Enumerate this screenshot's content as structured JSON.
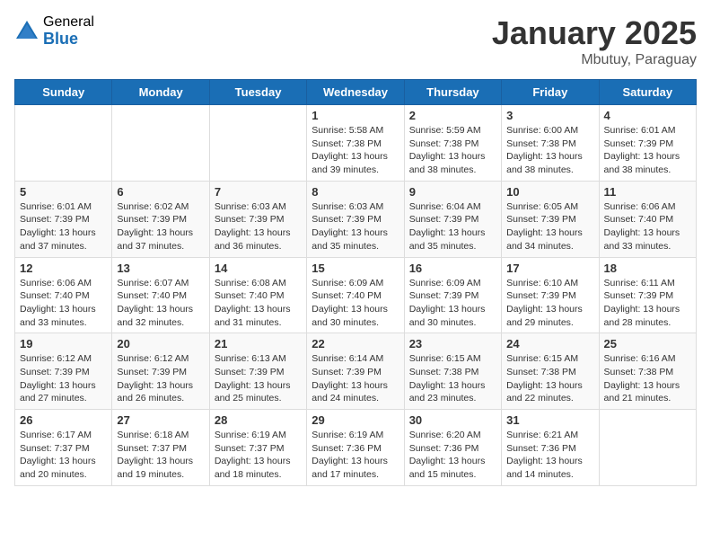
{
  "logo": {
    "general": "General",
    "blue": "Blue"
  },
  "header": {
    "month_title": "January 2025",
    "location": "Mbutuy, Paraguay"
  },
  "weekdays": [
    "Sunday",
    "Monday",
    "Tuesday",
    "Wednesday",
    "Thursday",
    "Friday",
    "Saturday"
  ],
  "weeks": [
    [
      {
        "day": "",
        "info": ""
      },
      {
        "day": "",
        "info": ""
      },
      {
        "day": "",
        "info": ""
      },
      {
        "day": "1",
        "info": "Sunrise: 5:58 AM\nSunset: 7:38 PM\nDaylight: 13 hours\nand 39 minutes."
      },
      {
        "day": "2",
        "info": "Sunrise: 5:59 AM\nSunset: 7:38 PM\nDaylight: 13 hours\nand 38 minutes."
      },
      {
        "day": "3",
        "info": "Sunrise: 6:00 AM\nSunset: 7:38 PM\nDaylight: 13 hours\nand 38 minutes."
      },
      {
        "day": "4",
        "info": "Sunrise: 6:01 AM\nSunset: 7:39 PM\nDaylight: 13 hours\nand 38 minutes."
      }
    ],
    [
      {
        "day": "5",
        "info": "Sunrise: 6:01 AM\nSunset: 7:39 PM\nDaylight: 13 hours\nand 37 minutes."
      },
      {
        "day": "6",
        "info": "Sunrise: 6:02 AM\nSunset: 7:39 PM\nDaylight: 13 hours\nand 37 minutes."
      },
      {
        "day": "7",
        "info": "Sunrise: 6:03 AM\nSunset: 7:39 PM\nDaylight: 13 hours\nand 36 minutes."
      },
      {
        "day": "8",
        "info": "Sunrise: 6:03 AM\nSunset: 7:39 PM\nDaylight: 13 hours\nand 35 minutes."
      },
      {
        "day": "9",
        "info": "Sunrise: 6:04 AM\nSunset: 7:39 PM\nDaylight: 13 hours\nand 35 minutes."
      },
      {
        "day": "10",
        "info": "Sunrise: 6:05 AM\nSunset: 7:39 PM\nDaylight: 13 hours\nand 34 minutes."
      },
      {
        "day": "11",
        "info": "Sunrise: 6:06 AM\nSunset: 7:40 PM\nDaylight: 13 hours\nand 33 minutes."
      }
    ],
    [
      {
        "day": "12",
        "info": "Sunrise: 6:06 AM\nSunset: 7:40 PM\nDaylight: 13 hours\nand 33 minutes."
      },
      {
        "day": "13",
        "info": "Sunrise: 6:07 AM\nSunset: 7:40 PM\nDaylight: 13 hours\nand 32 minutes."
      },
      {
        "day": "14",
        "info": "Sunrise: 6:08 AM\nSunset: 7:40 PM\nDaylight: 13 hours\nand 31 minutes."
      },
      {
        "day": "15",
        "info": "Sunrise: 6:09 AM\nSunset: 7:40 PM\nDaylight: 13 hours\nand 30 minutes."
      },
      {
        "day": "16",
        "info": "Sunrise: 6:09 AM\nSunset: 7:39 PM\nDaylight: 13 hours\nand 30 minutes."
      },
      {
        "day": "17",
        "info": "Sunrise: 6:10 AM\nSunset: 7:39 PM\nDaylight: 13 hours\nand 29 minutes."
      },
      {
        "day": "18",
        "info": "Sunrise: 6:11 AM\nSunset: 7:39 PM\nDaylight: 13 hours\nand 28 minutes."
      }
    ],
    [
      {
        "day": "19",
        "info": "Sunrise: 6:12 AM\nSunset: 7:39 PM\nDaylight: 13 hours\nand 27 minutes."
      },
      {
        "day": "20",
        "info": "Sunrise: 6:12 AM\nSunset: 7:39 PM\nDaylight: 13 hours\nand 26 minutes."
      },
      {
        "day": "21",
        "info": "Sunrise: 6:13 AM\nSunset: 7:39 PM\nDaylight: 13 hours\nand 25 minutes."
      },
      {
        "day": "22",
        "info": "Sunrise: 6:14 AM\nSunset: 7:39 PM\nDaylight: 13 hours\nand 24 minutes."
      },
      {
        "day": "23",
        "info": "Sunrise: 6:15 AM\nSunset: 7:38 PM\nDaylight: 13 hours\nand 23 minutes."
      },
      {
        "day": "24",
        "info": "Sunrise: 6:15 AM\nSunset: 7:38 PM\nDaylight: 13 hours\nand 22 minutes."
      },
      {
        "day": "25",
        "info": "Sunrise: 6:16 AM\nSunset: 7:38 PM\nDaylight: 13 hours\nand 21 minutes."
      }
    ],
    [
      {
        "day": "26",
        "info": "Sunrise: 6:17 AM\nSunset: 7:37 PM\nDaylight: 13 hours\nand 20 minutes."
      },
      {
        "day": "27",
        "info": "Sunrise: 6:18 AM\nSunset: 7:37 PM\nDaylight: 13 hours\nand 19 minutes."
      },
      {
        "day": "28",
        "info": "Sunrise: 6:19 AM\nSunset: 7:37 PM\nDaylight: 13 hours\nand 18 minutes."
      },
      {
        "day": "29",
        "info": "Sunrise: 6:19 AM\nSunset: 7:36 PM\nDaylight: 13 hours\nand 17 minutes."
      },
      {
        "day": "30",
        "info": "Sunrise: 6:20 AM\nSunset: 7:36 PM\nDaylight: 13 hours\nand 15 minutes."
      },
      {
        "day": "31",
        "info": "Sunrise: 6:21 AM\nSunset: 7:36 PM\nDaylight: 13 hours\nand 14 minutes."
      },
      {
        "day": "",
        "info": ""
      }
    ]
  ]
}
